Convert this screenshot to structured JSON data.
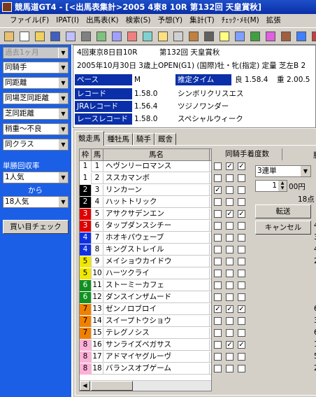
{
  "window": {
    "title": "競馬道GT4 - [<出馬表集計>2005 4東8 10R 第132回 天皇賞秋]"
  },
  "menu": [
    "ファイル(F)",
    "IPAT(I)",
    "出馬表(K)",
    "検索(S)",
    "予想(Y)",
    "集計(T)",
    "ﾁｪｯｸ･ﾒﾓ(M)",
    "拡張"
  ],
  "toolbar": {
    "icons": [
      "person-icon",
      "page-icon",
      "open-icon",
      "save-icon",
      "list-icon",
      "print-icon",
      "grid-icon",
      "table-icon",
      "chart-icon",
      "sheet-icon",
      "memo-icon",
      "calendar-icon",
      "horse-icon",
      "camera-icon",
      "notes-icon",
      "book-icon",
      "eye-icon",
      "music-icon",
      "user-icon",
      "help-icon",
      "exit-icon"
    ]
  },
  "sidebar": {
    "period": "過去1ヶ月",
    "filters": [
      "同騎手",
      "同距離",
      "同場芝同距離",
      "芝同距離",
      "稍重〜不良",
      "同クラス"
    ],
    "odds_label": "単勝回収率",
    "from_value": "1人気",
    "from_label": "から",
    "to_value": "18人気",
    "check_button": "買い目チェック"
  },
  "race": {
    "meeting": "4回東京8日目10R",
    "name": "第132回 天皇賞秋",
    "detail": "2005年10月30日 3歳上OPEN(G1) (国際)牡・牝(指定) 定量 芝左B 2",
    "pace_label": "ペース",
    "pace_value": "M",
    "est_label": "推定タイム",
    "good_label": "良",
    "good_time": "1.58.4",
    "heavy_label": "重",
    "heavy_time": "2.00.5",
    "records": [
      {
        "label": "レコード",
        "time": "1.58.0",
        "horse": "シンボリクリスエス"
      },
      {
        "label": "JRAレコード",
        "time": "1.56.4",
        "horse": "ツジノワンダー"
      },
      {
        "label": "レースレコード",
        "time": "1.58.0",
        "horse": "スペシャルウィーク"
      }
    ]
  },
  "tabs": [
    "競走馬",
    "種牡馬",
    "騎手",
    "厩舎"
  ],
  "table": {
    "headers": {
      "frame": "枠",
      "num": "馬",
      "name": "馬名",
      "jockey": "同騎手着度数",
      "extra": "勝"
    },
    "rows": [
      {
        "frame": "1",
        "num": "1",
        "name": "ヘヴンリーロマンス",
        "c1": false,
        "c2": true,
        "c3": true
      },
      {
        "frame": "1",
        "num": "2",
        "name": "ススカマンボ",
        "c1": false,
        "c2": false,
        "c3": false
      },
      {
        "frame": "2",
        "num": "3",
        "name": "リンカーン",
        "c1": true,
        "c2": false,
        "c3": false
      },
      {
        "frame": "2",
        "num": "4",
        "name": "ハットトリック",
        "c1": false,
        "c2": false,
        "c3": false
      },
      {
        "frame": "3",
        "num": "5",
        "name": "アサクサデンエン",
        "c1": false,
        "c2": true,
        "c3": true
      },
      {
        "frame": "3",
        "num": "6",
        "name": "タップダンスシチー",
        "c1": false,
        "c2": false,
        "c3": false
      },
      {
        "frame": "4",
        "num": "7",
        "name": "ホオキパウェーブ",
        "c1": false,
        "c2": false,
        "c3": false
      },
      {
        "frame": "4",
        "num": "8",
        "name": "キングストレイル",
        "c1": false,
        "c2": false,
        "c3": false
      },
      {
        "frame": "5",
        "num": "9",
        "name": "メイショウカイドウ",
        "c1": false,
        "c2": false,
        "c3": false
      },
      {
        "frame": "5",
        "num": "10",
        "name": "ハーツクライ",
        "c1": false,
        "c2": false,
        "c3": false
      },
      {
        "frame": "6",
        "num": "11",
        "name": "ストーミーカフェ",
        "c1": false,
        "c2": false,
        "c3": false
      },
      {
        "frame": "6",
        "num": "12",
        "name": "ダンスインザムード",
        "c1": false,
        "c2": false,
        "c3": false
      },
      {
        "frame": "7",
        "num": "13",
        "name": "ゼンノロブロイ",
        "c1": true,
        "c2": true,
        "c3": true
      },
      {
        "frame": "7",
        "num": "14",
        "name": "スイープトウショウ",
        "c1": false,
        "c2": false,
        "c3": false
      },
      {
        "frame": "7",
        "num": "15",
        "name": "テレグノシス",
        "c1": false,
        "c2": false,
        "c3": false
      },
      {
        "frame": "8",
        "num": "16",
        "name": "サンライズペガサス",
        "c1": false,
        "c2": true,
        "c3": true
      },
      {
        "frame": "8",
        "num": "17",
        "name": "アドマイヤグルーヴ",
        "c1": false,
        "c2": false,
        "c3": false
      },
      {
        "frame": "8",
        "num": "18",
        "name": "バランスオブゲーム",
        "c1": false,
        "c2": false,
        "c3": false
      }
    ],
    "right_col": [
      "2",
      "1",
      "2",
      "3",
      "2",
      "4",
      "3",
      "4",
      "2",
      "",
      "",
      "",
      "6",
      "3",
      "6",
      "10",
      "5",
      "2"
    ]
  },
  "bet": {
    "type": "3連単",
    "amount": "1",
    "unit": "00円",
    "points": "18点",
    "transfer_button": "転送",
    "cancel_button": "キャンセル"
  },
  "colors": {
    "frame1": "#ffffff",
    "frame2": "#000000",
    "frame3": "#e00000",
    "frame4": "#1030e0",
    "frame5": "#f0e800",
    "frame6": "#109020",
    "frame7": "#f08000",
    "frame8": "#ffb0d8",
    "sidebar": "#1b5fe6",
    "label": "#0a2fa8"
  }
}
